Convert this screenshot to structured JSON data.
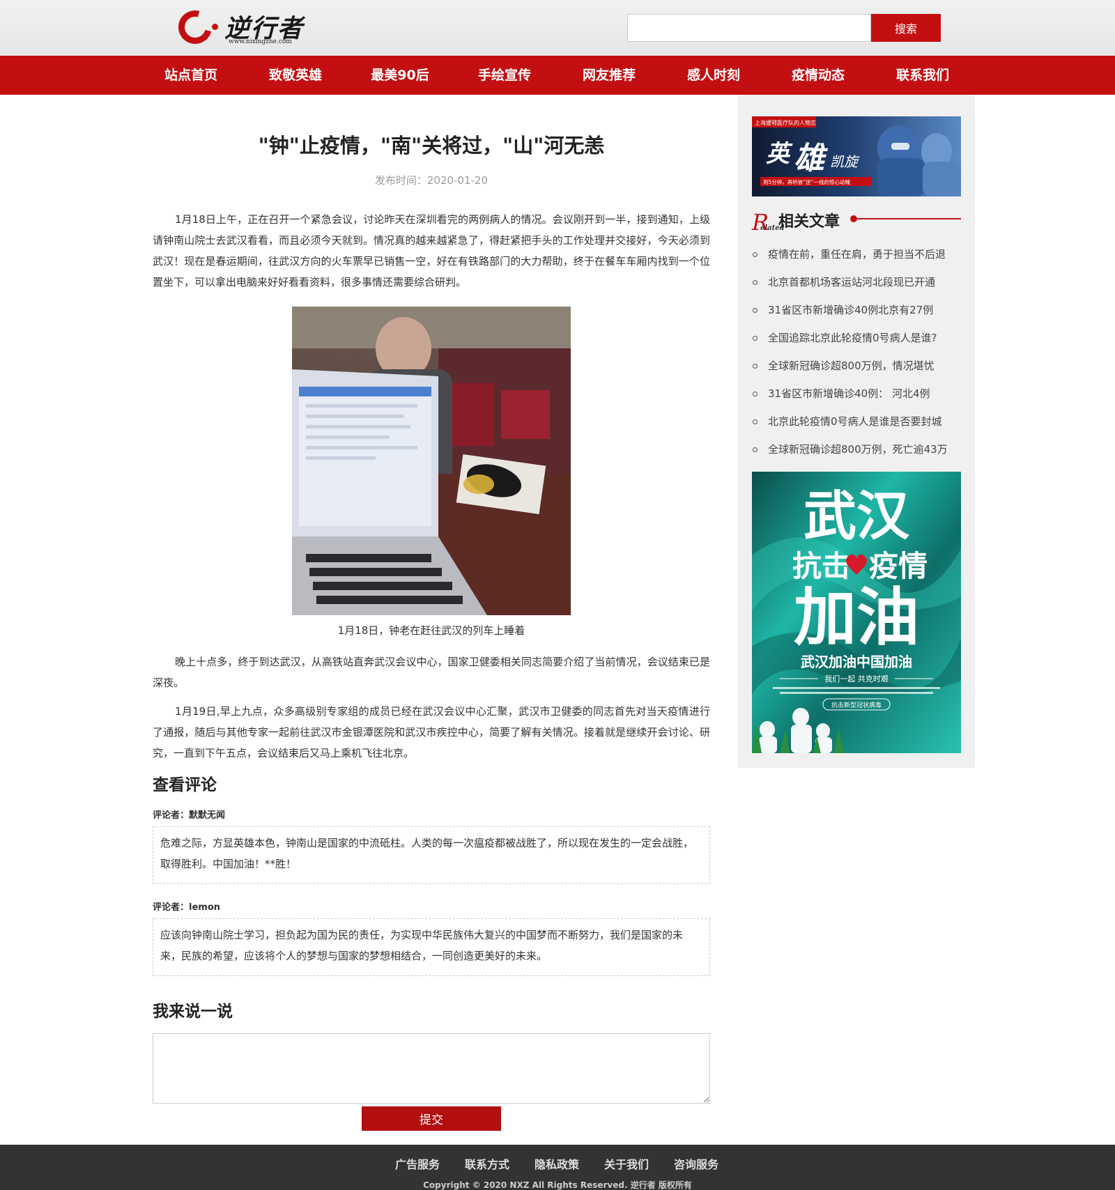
{
  "header": {
    "logo_text": "逆行者",
    "logo_url": "www.nixingzhe.com",
    "search_placeholder": "",
    "search_button": "搜索"
  },
  "nav": {
    "items": [
      "站点首页",
      "致敬英雄",
      "最美90后",
      "手绘宣传",
      "网友推荐",
      "感人时刻",
      "疫情动态",
      "联系我们"
    ]
  },
  "article": {
    "title": "\"钟\"止疫情，\"南\"关将过，\"山\"河无恙",
    "pubtime": "发布时间：2020-01-20",
    "para1": "1月18日上午，正在召开一个紧急会议，讨论昨天在深圳看完的两例病人的情况。会议刚开到一半，接到通知，上级请钟南山院士去武汉看看，而且必须今天就到。情况真的越来越紧急了，得赶紧把手头的工作处理并交接好，今天必须到武汉！现在是春运期间，往武汉方向的火车票早已销售一空，好在有铁路部门的大力帮助，终于在餐车车厢内找到一个位置坐下，可以拿出电脑来好好看看资料，很多事情还需要综合研判。",
    "caption": "1月18日，钟老在赶往武汉的列车上睡着",
    "para2": "晚上十点多，终于到达武汉，从高铁站直奔武汉会议中心，国家卫健委相关同志简要介绍了当前情况，会议结束已是深夜。",
    "para3": "1月19日,早上九点，众多高级别专家组的成员已经在武汉会议中心汇聚，武汉市卫健委的同志首先对当天疫情进行了通报，随后与其他专家一起前往武汉市金银潭医院和武汉市疾控中心，简要了解有关情况。接着就是继续开会讨论、研究，一直到下午五点，会议结束后又马上乘机飞往北京。"
  },
  "comments": {
    "heading": "查看评论",
    "list": [
      {
        "author": "评论者：默默无闻",
        "text": "危难之际，方显英雄本色，钟南山是国家的中流砥柱。人类的每一次瘟疫都被战胜了，所以现在发生的一定会战胜，取得胜利。中国加油！**胜！"
      },
      {
        "author": "评论者：lemon",
        "text": "应该向钟南山院士学习，担负起为国为民的责任，为实现中华民族伟大复兴的中国梦而不断努力，我们是国家的未来，民族的希望，应该将个人的梦想与国家的梦想相结合，一同创造更美好的未来。"
      }
    ]
  },
  "reply": {
    "heading": "我来说一说",
    "submit": "提交"
  },
  "sidebar": {
    "hero_banner": {
      "tag": "上海援鄂医疗队的人物志",
      "title_a": "英",
      "title_b": "雄",
      "title_c": "凯旋",
      "sub": "用5分钟，再听彼“逆”一线的惊心动魄"
    },
    "related_r": "R",
    "related_sub": "elated",
    "related_title": "相关文章",
    "related": [
      "疫情在前，重任在肩，勇于担当不后退",
      "北京首都机场客运站河北段现已开通",
      "31省区市新增确诊40例北京有27例",
      "全国追踪北京此轮疫情0号病人是谁?",
      "全球新冠确诊超800万例，情况堪忧",
      "31省区市新增确诊40例： 河北4例",
      "北京此轮疫情0号病人是谁是否要封城",
      "全球新冠确诊超800万例，死亡逾43万"
    ],
    "poster": {
      "line1": "武汉",
      "line2a": "抗击",
      "line2b": "疫情",
      "line3": "加油",
      "slogan": "武汉加油中国加油",
      "sub": "我们一起 共克时艰",
      "tag": "抗击新型冠状病毒"
    }
  },
  "footer": {
    "links": [
      "广告服务",
      "联系方式",
      "隐私政策",
      "关于我们",
      "咨询服务"
    ],
    "copyright": "Copyright © 2020 NXZ All Rights Reserved. 逆行者 版权所有"
  },
  "colors": {
    "brand_red": "#c40f12",
    "footer_bg": "#333333",
    "sidebar_bg": "#f0f0f0"
  }
}
